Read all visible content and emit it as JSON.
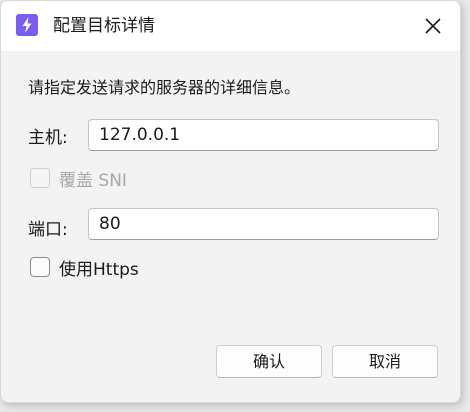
{
  "dialog": {
    "title": "配置目标详情",
    "description": "请指定发送请求的服务器的详细信息。"
  },
  "host": {
    "label": "主机:",
    "value": "127.0.0.1"
  },
  "sni": {
    "label": "覆盖 SNI",
    "checked": false,
    "enabled": false
  },
  "port": {
    "label": "端口:",
    "value": "80"
  },
  "https": {
    "label": "使用Https",
    "checked": false
  },
  "buttons": {
    "ok": "确认",
    "cancel": "取消"
  },
  "icons": {
    "app": "lightning-bolt-icon",
    "close": "close-icon"
  },
  "colors": {
    "accent": "#7b5cf0"
  }
}
